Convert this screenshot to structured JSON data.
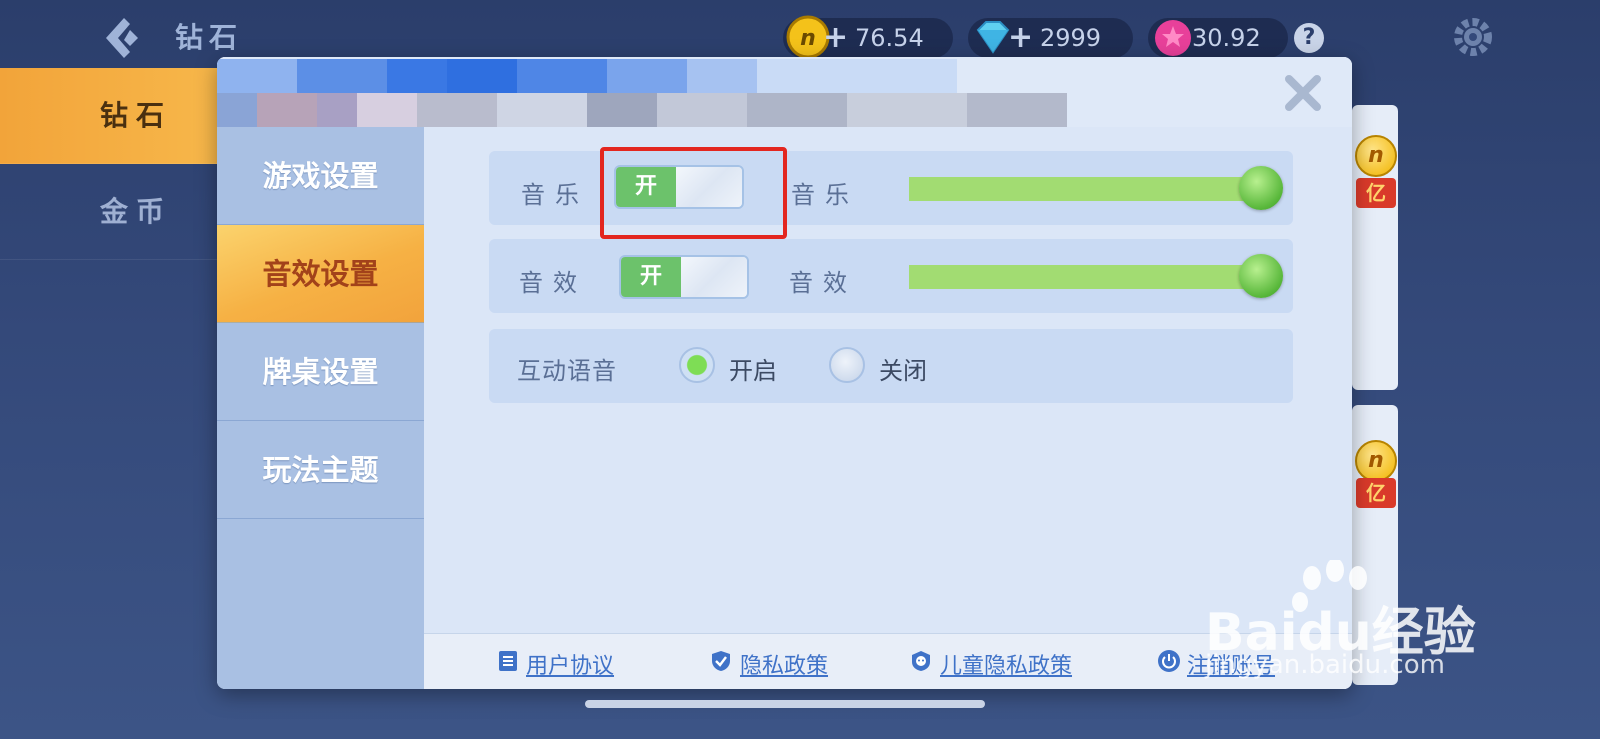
{
  "topbar": {
    "title": "钻石",
    "currencies": [
      {
        "icon": "coin-icon",
        "value": "76.54万"
      },
      {
        "icon": "diamond-icon",
        "value": "2999"
      },
      {
        "icon": "gem-icon",
        "value": "30.92万"
      }
    ],
    "help_label": "?"
  },
  "leftnav": {
    "items": [
      {
        "label": "钻石",
        "active": true
      },
      {
        "label": "金币",
        "active": false
      }
    ]
  },
  "modal": {
    "tabs": [
      {
        "label": "游戏设置",
        "active": false
      },
      {
        "label": "音效设置",
        "active": true
      },
      {
        "label": "牌桌设置",
        "active": false
      },
      {
        "label": "玩法主题",
        "active": false
      }
    ],
    "music": {
      "label": "音乐",
      "toggle_label": "开",
      "slider_label": "音乐",
      "volume": 1.0
    },
    "sound_effects": {
      "label": "音效",
      "toggle_label": "开",
      "slider_label": "音效",
      "volume": 1.0
    },
    "voice": {
      "label": "互动语音",
      "option_on": "开启",
      "option_off": "关闭",
      "selected": "开启"
    },
    "footer": {
      "user_agreement": "用户协议",
      "privacy_policy": "隐私政策",
      "child_privacy_policy": "儿童隐私政策",
      "cancel_account": "注销账号"
    }
  },
  "side_cards": {
    "ribbon_text": "亿"
  },
  "watermark": {
    "brand": "Baidu经验",
    "url": "jingyan.baidu.com"
  },
  "colors": {
    "accent_orange": "#f6b144",
    "toggle_on": "#6cc26b",
    "slider_fill": "#a2dc72",
    "highlight_red": "#e3261f"
  }
}
